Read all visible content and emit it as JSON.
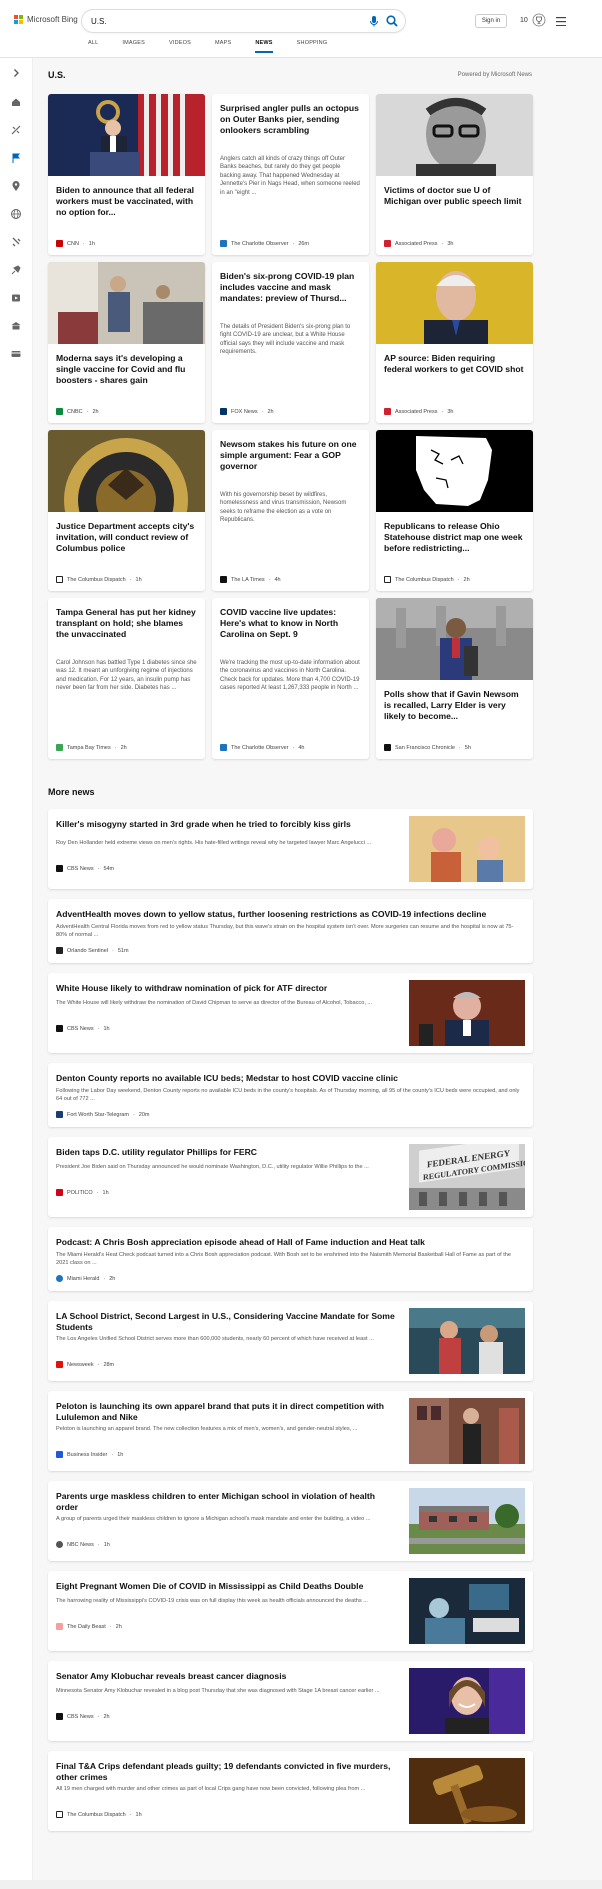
{
  "header": {
    "logo_text": "Microsoft Bing",
    "search_value": "U.S.",
    "signin_label": "Sign in",
    "rewards_count": "10",
    "tabs": [
      {
        "label": "ALL"
      },
      {
        "label": "IMAGES"
      },
      {
        "label": "VIDEOS"
      },
      {
        "label": "MAPS"
      },
      {
        "label": "NEWS"
      },
      {
        "label": "SHOPPING"
      }
    ]
  },
  "colors": {
    "accent": "#0067b8",
    "ms_red": "#f25022",
    "ms_green": "#7fba00",
    "ms_blue": "#00a4ef",
    "ms_yellow": "#ffb900"
  },
  "rail_icons": [
    "expand-icon",
    "home-icon",
    "world-icon",
    "flag-icon",
    "location-icon",
    "globe-icon",
    "politics-icon",
    "science-icon",
    "entertainment-icon",
    "business-icon",
    "money-icon"
  ],
  "section": {
    "title": "U.S.",
    "powered_by": "Powered by Microsoft News"
  },
  "top_cards": [
    {
      "title": "Biden to announce that all federal workers must be vaccinated, with no option for...",
      "source": "CNN",
      "time": "1h",
      "favicon": "#cc0000",
      "image": "biden-podium"
    },
    {
      "title": "Surprised angler pulls an octopus on Outer Banks pier, sending onlookers scrambling",
      "snippet": "Anglers catch all kinds of crazy things off Outer Banks beaches, but rarely do they get people backing away. That happened Wednesday at Jennette's Pier in Nags Head, when someone reeled in an \"eight ...",
      "source": "The Charlotte Observer",
      "time": "26m",
      "favicon": "#1e73be"
    },
    {
      "title": "Victims of doctor sue U of Michigan over public speech limit",
      "source": "Associated Press",
      "time": "3h",
      "favicon": "#d22030",
      "image": "doctor-portrait"
    },
    {
      "title": "Moderna says it's developing a single vaccine for Covid and flu boosters - shares gain",
      "source": "CNBC",
      "time": "2h",
      "favicon": "#0a8a3a",
      "image": "vaccine-clinic"
    },
    {
      "title": "Biden's six-prong COVID-19 plan includes vaccine and mask mandates: preview of Thursd...",
      "snippet": "The details of President Biden's six-prong plan to fight COVID-19 are unclear, but a White House official says they will include vaccine and mask requirements.",
      "source": "FOX News",
      "time": "2h",
      "favicon": "#003366"
    },
    {
      "title": "AP source: Biden requiring federal workers to get COVID shot",
      "source": "Associated Press",
      "time": "3h",
      "favicon": "#d22030",
      "image": "biden-yellow"
    },
    {
      "title": "Justice Department accepts city's invitation, will conduct review of Columbus police",
      "source": "The Columbus Dispatch",
      "time": "1h",
      "favicon": "#222222",
      "image": "doj-seal"
    },
    {
      "title": "Newsom stakes his future on one simple argument: Fear a GOP governor",
      "snippet": "With his governorship beset by wildfires, homelessness and virus transmission, Newsom seeks to reframe the election as a vote on Republicans.",
      "source": "The LA Times",
      "time": "4h",
      "favicon": "#111111"
    },
    {
      "title": "Republicans to release Ohio Statehouse district map one week before redistricting...",
      "source": "The Columbus Dispatch",
      "time": "2h",
      "favicon": "#222222",
      "image": "ohio-map"
    },
    {
      "title": "Tampa General has put her kidney transplant on hold; she blames the unvaccinated",
      "snippet": "Carol Johnson has battled Type 1 diabetes since she was 12. It meant an unforgiving regime of injections and medication. For 12 years, an insulin pump has never been far from her side. Diabetes has ...",
      "source": "Tampa Bay Times",
      "time": "2h",
      "favicon": "#3aa655"
    },
    {
      "title": "COVID vaccine live updates: Here's what to know in North Carolina on Sept. 9",
      "snippet": "We're tracking the most up-to-date information about the coronavirus and vaccines in North Carolina. Check back for updates. More than 4,700 COVID-19 cases reported At least 1,267,333 people in North ...",
      "source": "The Charlotte Observer",
      "time": "4h",
      "favicon": "#1e73be"
    },
    {
      "title": "Polls show that if Gavin Newsom is recalled, Larry Elder is very likely to become...",
      "source": "San Francisco Chronicle",
      "time": "5h",
      "favicon": "#111111",
      "image": "elder-speech"
    }
  ],
  "more_news": {
    "title": "More news",
    "items": [
      {
        "title": "Killer's misogyny started in 3rd grade when he tried to forcibly kiss girls",
        "snippet": "Roy Den Hollander held extreme views on men's rights. His hate-filled writings reveal why he targeted lawyer Marc Angelucci ...",
        "source": "CBS News",
        "time": "54m",
        "favicon": "#111111",
        "image": "family-photo"
      },
      {
        "title": "AdventHealth moves down to yellow status, further loosening restrictions as COVID-19 infections decline",
        "snippet": "AdventHealth Central Florida moves from red to yellow status Thursday, but this wave's strain on the hospital system isn't over. More surgeries can resume and the hospital is now at 75-80% of normal ...",
        "source": "Orlando Sentinel",
        "time": "51m",
        "favicon": "#222222"
      },
      {
        "title": "White House likely to withdraw nomination of pick for ATF director",
        "snippet": "The White House will likely withdraw the nomination of David Chipman to serve as director of the Bureau of Alcohol, Tobacco, ...",
        "source": "CBS News",
        "time": "1h",
        "favicon": "#111111",
        "image": "chipman"
      },
      {
        "title": "Denton County reports no available ICU beds; Medstar to host COVID vaccine clinic",
        "snippet": "Following the Labor Day weekend, Denton County reports no available ICU beds in the county's hospitals. As of Thursday morning, all 95 of the county's ICU beds were occupied, and only 64 out of 772 ...",
        "source": "Fort Worth Star-Telegram",
        "time": "20m",
        "favicon": "#1a3e6e"
      },
      {
        "title": "Biden taps D.C. utility regulator Phillips for FERC",
        "snippet": "President Joe Biden said on Thursday announced he would nominate Washington, D.C., utility regulator Willie Phillips to the ...",
        "source": "POLITICO",
        "time": "1h",
        "favicon": "#d0021b",
        "image": "ferc-sign",
        "sign_line1": "FEDERAL ENERGY",
        "sign_line2": "REGULATORY COMMISSION"
      },
      {
        "title": "Podcast: A Chris Bosh appreciation episode ahead of Hall of Fame induction and Heat talk",
        "snippet": "The Miami Herald's Heat Check podcast turned into a Chris Bosh appreciation podcast. With Bosh set to be enshrined into the Naismith Memorial Basketball Hall of Fame as part of the 2021 class on ...",
        "source": "Miami Herald",
        "time": "2h",
        "favicon": "#1e73be"
      },
      {
        "title": "LA School District, Second Largest in U.S., Considering Vaccine Mandate for Some Students",
        "snippet": "The Los Angeles Unified School District serves more than 600,000 students, nearly 60 percent of which have received at least ...",
        "source": "Newsweek",
        "time": "28m",
        "favicon": "#e3120b",
        "image": "la-school"
      },
      {
        "title": "Peloton is launching its own apparel brand that puts it in direct competition with Lululemon and Nike",
        "snippet": "Peloton is launching an apparel brand. The new collection features a mix of men's, women's, and gender-neutral styles, ...",
        "source": "Business Insider",
        "time": "1h",
        "favicon": "#1f5bd8",
        "image": "peloton"
      },
      {
        "title": "Parents urge maskless children to enter Michigan school in violation of health order",
        "snippet": "A group of parents urged their maskless children to ignore a Michigan school's mask mandate and enter the building, a video ...",
        "source": "NBC News",
        "time": "1h",
        "favicon": "#555555",
        "image": "michigan-school"
      },
      {
        "title": "Eight Pregnant Women Die of COVID in Mississippi as Child Deaths Double",
        "snippet": "The harrowing reality of Mississippi's COVID-19 crisis was on full display this week as health officials announced the deaths ...",
        "source": "The Daily Beast",
        "time": "2h",
        "favicon": "#f2a0a0",
        "image": "hospital"
      },
      {
        "title": "Senator Amy Klobuchar reveals breast cancer diagnosis",
        "snippet": "Minnesota Senator Amy Klobuchar revealed in a blog post Thursday that she was diagnosed with Stage 1A breast cancer earlier ...",
        "source": "CBS News",
        "time": "2h",
        "favicon": "#111111",
        "image": "klobuchar"
      },
      {
        "title": "Final T&A Crips defendant pleads guilty; 19 defendants convicted in five murders, other crimes",
        "snippet": "All 19 men charged with murder and other crimes as part of local Crips gang have now been convicted, following plea from ...",
        "source": "The Columbus Dispatch",
        "time": "1h",
        "favicon": "#222222",
        "image": "gavel"
      }
    ]
  }
}
